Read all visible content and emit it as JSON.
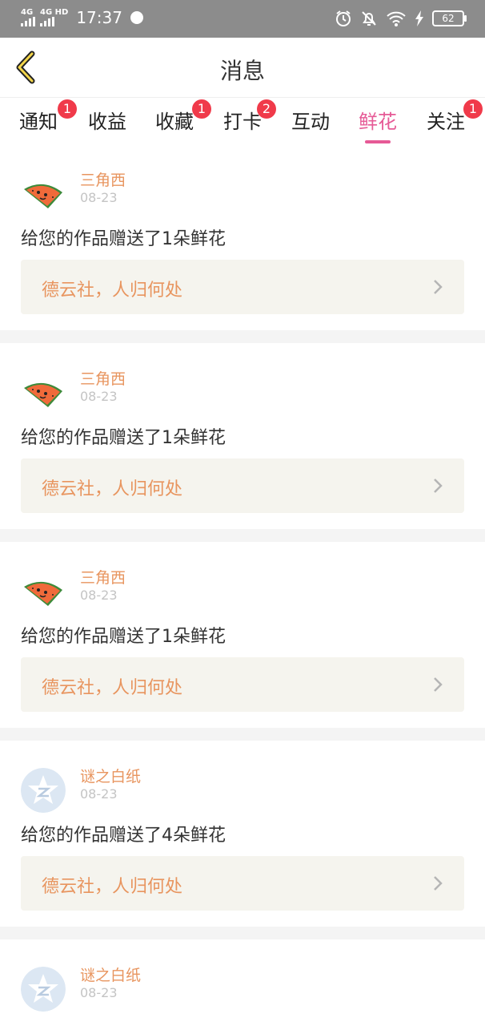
{
  "status_bar": {
    "net1": "4G",
    "net2": "4G HD",
    "time": "17:37",
    "battery": "62"
  },
  "header": {
    "title": "消息"
  },
  "tabs": [
    {
      "label": "通知",
      "badge": "1"
    },
    {
      "label": "收益",
      "badge": null
    },
    {
      "label": "收藏",
      "badge": "1"
    },
    {
      "label": "打卡",
      "badge": "2"
    },
    {
      "label": "互动",
      "badge": null
    },
    {
      "label": "鲜花",
      "badge": null,
      "active": true
    },
    {
      "label": "关注",
      "badge": "1"
    }
  ],
  "feed": [
    {
      "user": "三角西",
      "date": "08-23",
      "message": "给您的作品赠送了1朵鲜花",
      "work": "德云社，人归何处",
      "avatar": "watermelon-avatar"
    },
    {
      "user": "三角西",
      "date": "08-23",
      "message": "给您的作品赠送了1朵鲜花",
      "work": "德云社，人归何处",
      "avatar": "watermelon-avatar"
    },
    {
      "user": "三角西",
      "date": "08-23",
      "message": "给您的作品赠送了1朵鲜花",
      "work": "德云社，人归何处",
      "avatar": "watermelon-avatar"
    },
    {
      "user": "谜之白纸",
      "date": "08-23",
      "message": "给您的作品赠送了4朵鲜花",
      "work": "德云社，人归何处",
      "avatar": "default-star-avatar"
    },
    {
      "user": "谜之白纸",
      "date": "08-23",
      "message": "",
      "work": "",
      "avatar": "default-star-avatar"
    }
  ],
  "colors": {
    "accent": "#e65a96",
    "name": "#e8955f",
    "badge": "#f03a4a",
    "card_bg": "#f5f4ee"
  }
}
